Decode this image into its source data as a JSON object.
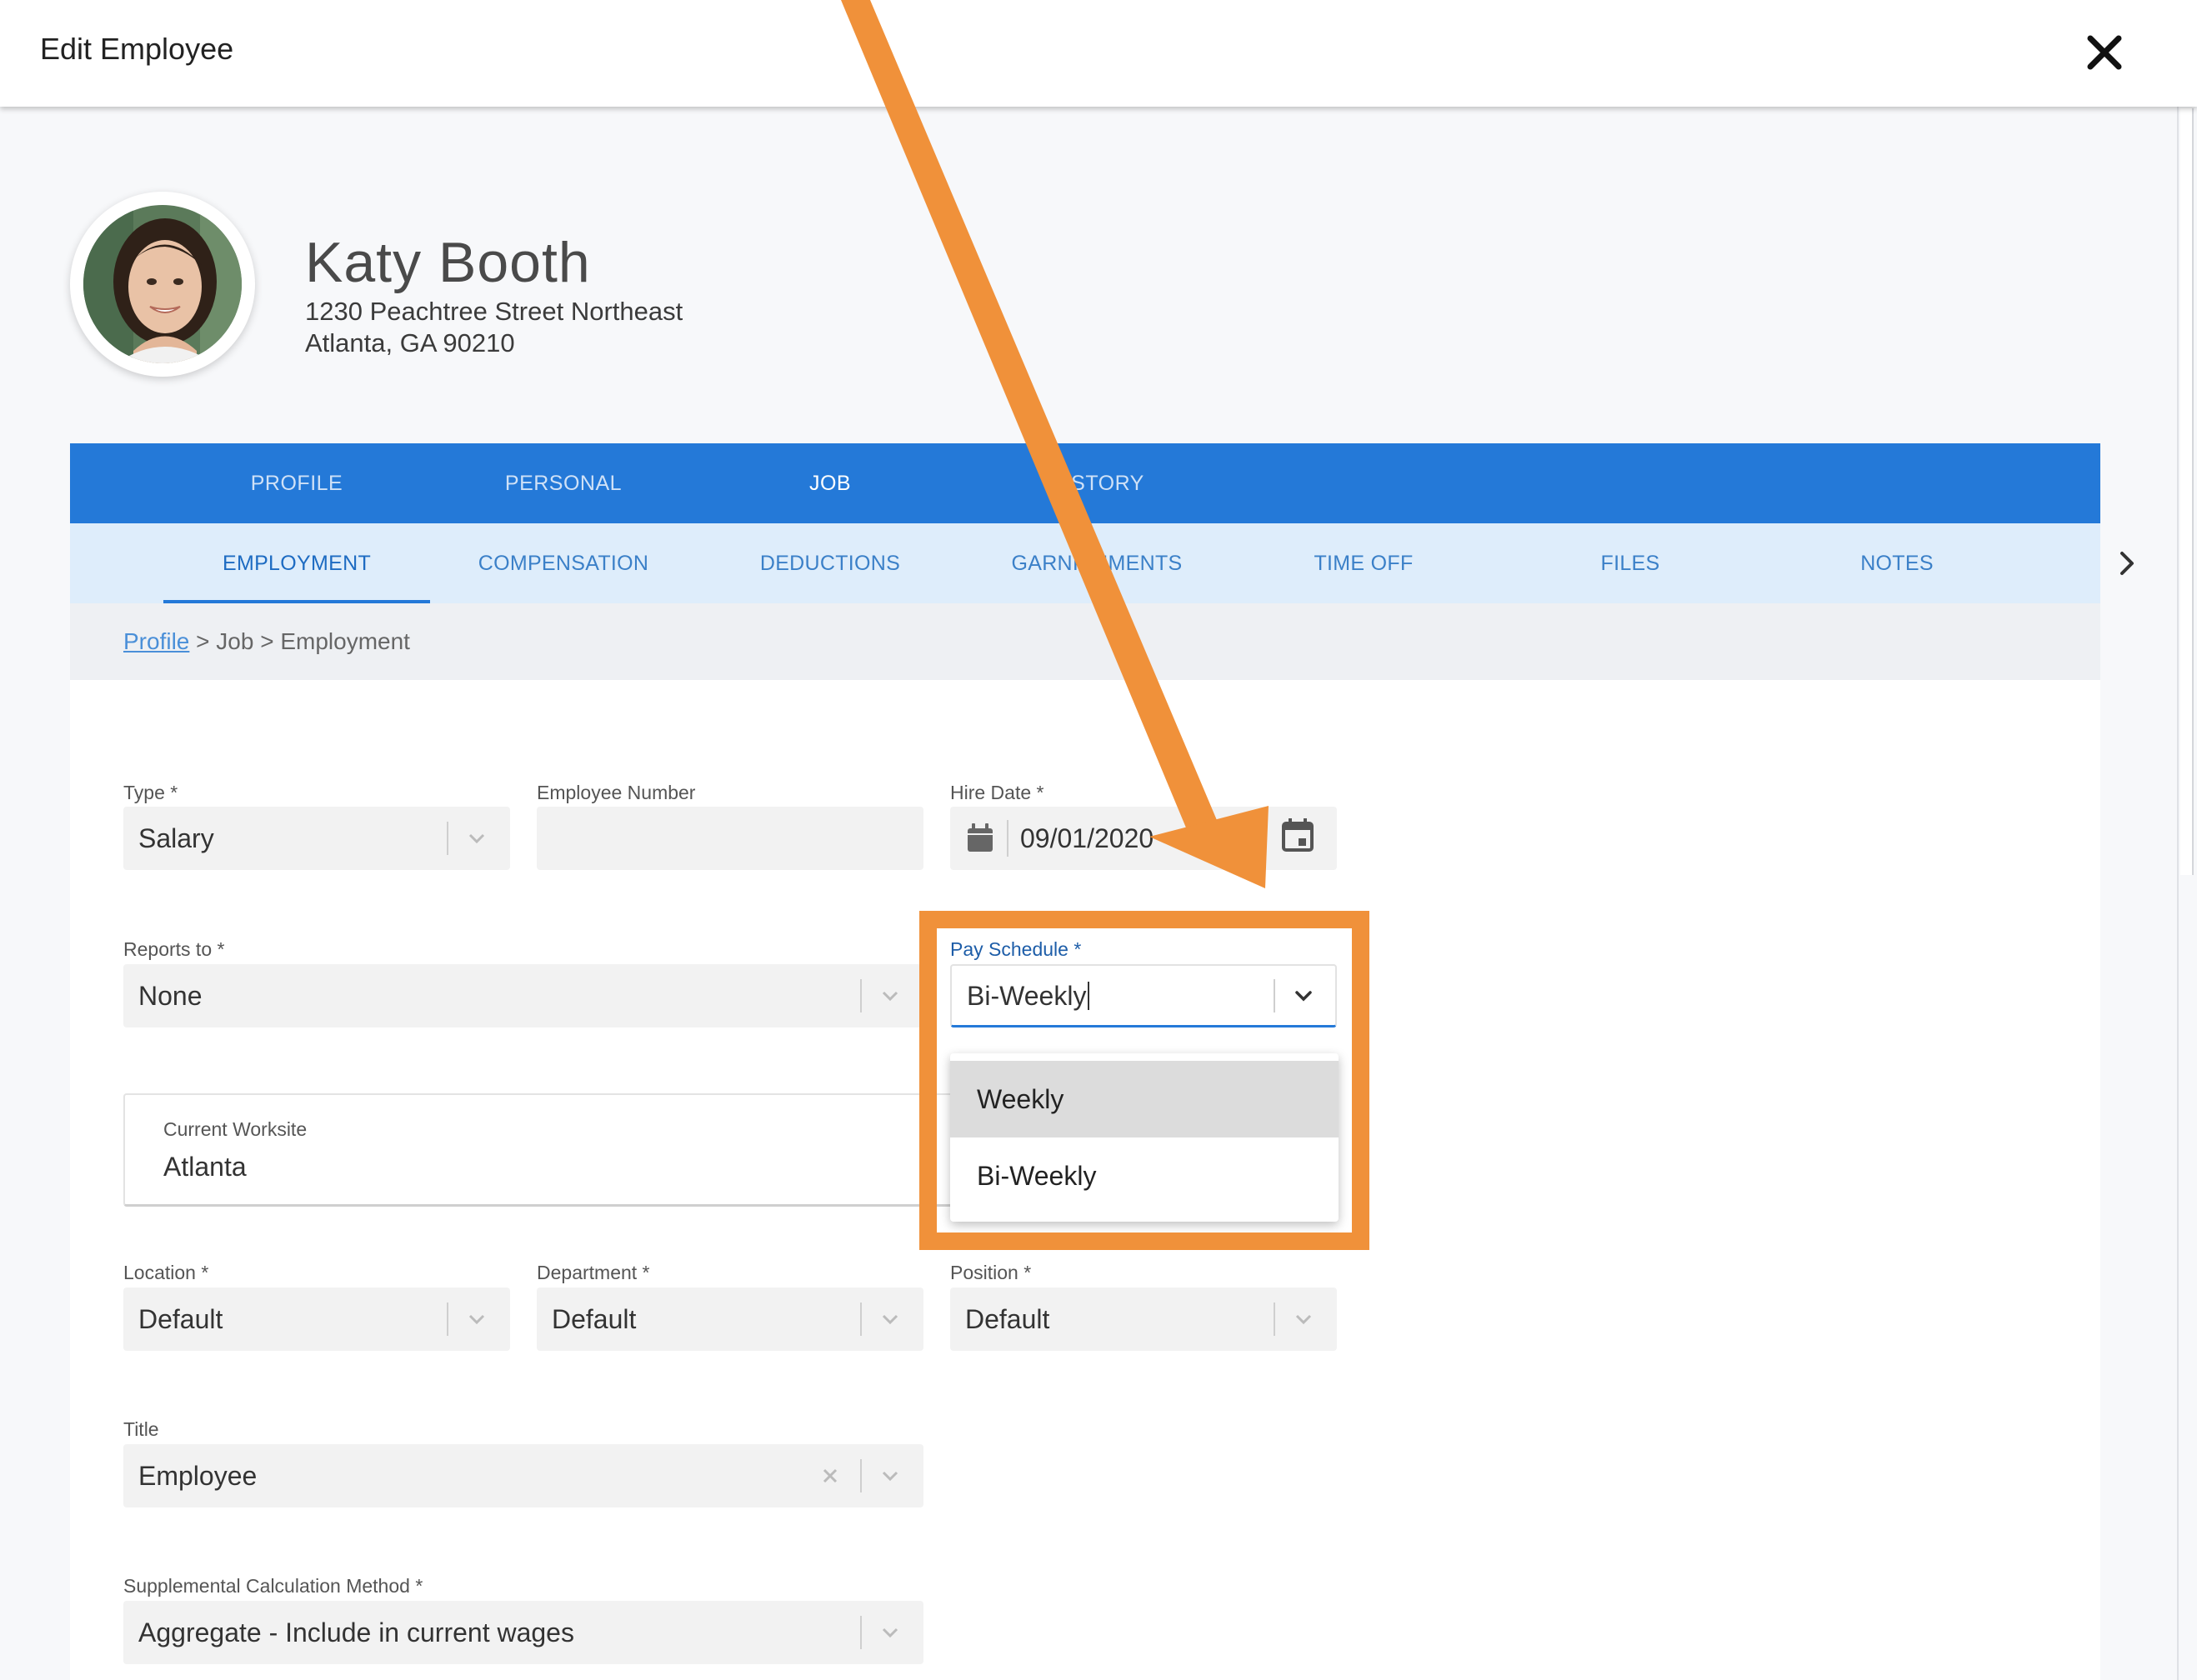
{
  "modal": {
    "title": "Edit Employee"
  },
  "employee": {
    "name": "Katy Booth",
    "address_line1": "1230 Peachtree Street Northeast",
    "address_line2": "Atlanta, GA 90210"
  },
  "main_tabs": [
    "PROFILE",
    "PERSONAL",
    "JOB",
    "HISTORY"
  ],
  "main_tab_active": "JOB",
  "sub_tabs": [
    "EMPLOYMENT",
    "COMPENSATION",
    "DEDUCTIONS",
    "GARNISHMENTS",
    "TIME OFF",
    "FILES",
    "NOTES"
  ],
  "sub_tab_active": "EMPLOYMENT",
  "breadcrumb": {
    "link": "Profile",
    "rest": " > Job > Employment"
  },
  "fields": {
    "type": {
      "label": "Type *",
      "value": "Salary"
    },
    "employee_number": {
      "label": "Employee Number",
      "value": ""
    },
    "hire_date": {
      "label": "Hire Date *",
      "value": "09/01/2020"
    },
    "reports_to": {
      "label": "Reports to *",
      "value": "None"
    },
    "pay_schedule": {
      "label": "Pay Schedule *",
      "value": "Bi-Weekly",
      "options": [
        "Weekly",
        "Bi-Weekly"
      ],
      "highlighted_option": "Weekly"
    },
    "current_worksite": {
      "label": "Current Worksite",
      "value": "Atlanta"
    },
    "location": {
      "label": "Location *",
      "value": "Default"
    },
    "department": {
      "label": "Department *",
      "value": "Default"
    },
    "position": {
      "label": "Position *",
      "value": "Default"
    },
    "title": {
      "label": "Title",
      "value": "Employee"
    },
    "supplemental": {
      "label": "Supplemental Calculation Method *",
      "value": "Aggregate - Include in current wages"
    }
  },
  "colors": {
    "tab_bar": "#2479d8",
    "sub_tab_bar": "#deedfb",
    "annotation": "#f0913a",
    "focus": "#2479d8"
  },
  "icons": [
    "close-icon",
    "calendar-icon",
    "chevron-down-icon",
    "chevron-right-icon",
    "clear-icon"
  ]
}
